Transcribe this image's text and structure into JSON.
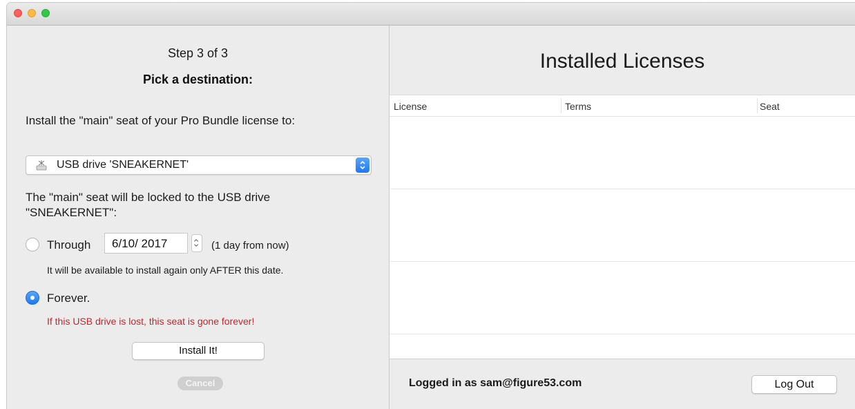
{
  "window": {
    "buttons": [
      "close",
      "minimize",
      "zoom"
    ]
  },
  "wizard": {
    "step": "Step 3 of 3",
    "heading": "Pick a destination:",
    "install_prompt": "Install the \"main\" seat of your Pro Bundle license to:",
    "destination": {
      "selected": "USB drive 'SNEAKERNET'",
      "icon": "usb-drive-icon"
    },
    "lock_description": "The \"main\" seat will be locked to the USB drive \"SNEAKERNET\":",
    "options": {
      "through": {
        "label": "Through",
        "date": "6/10/ 2017",
        "relative": "(1 day from now)",
        "note": "It will be available to install again only AFTER this date.",
        "selected": false
      },
      "forever": {
        "label": "Forever.",
        "warning": "If this USB drive is lost, this seat is gone forever!",
        "selected": true
      }
    },
    "install_button": "Install It!",
    "cancel_button": "Cancel"
  },
  "licenses": {
    "title": "Installed Licenses",
    "columns": [
      "License",
      "Terms",
      "Seat"
    ],
    "rows": []
  },
  "account": {
    "logged_in_text": "Logged in as sam@figure53.com",
    "logout_button": "Log Out"
  },
  "colors": {
    "accent": "#1e78f2",
    "warning": "#c0262b"
  }
}
